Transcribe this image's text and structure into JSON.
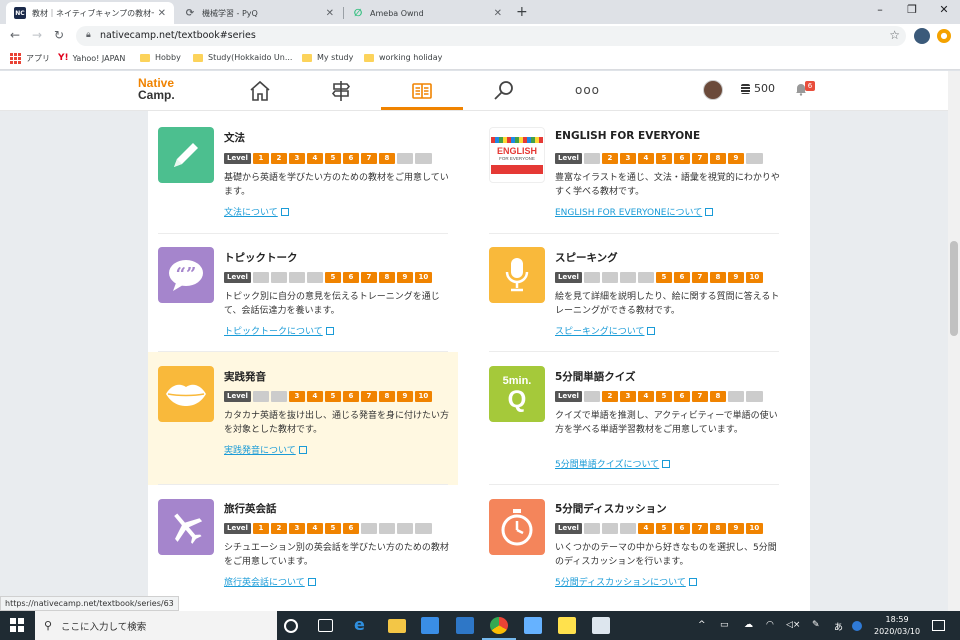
{
  "browser": {
    "tabs": [
      {
        "favicon": "NC",
        "title": "教材｜ネイティブキャンプの教材一覧",
        "active": true
      },
      {
        "favicon": "⟳",
        "title": "機械学習 - PyQ",
        "active": false
      },
      {
        "favicon": "∅",
        "title": "Ameba Ownd",
        "active": false
      }
    ],
    "url": "nativecamp.net/textbook#series",
    "bookmarks": [
      "アプリ",
      "Yahoo! JAPAN",
      "Hobby",
      "Study(Hokkaido Un...",
      "My study",
      "working holiday"
    ]
  },
  "site": {
    "logo_line1": "Native",
    "logo_line2": "Camp.",
    "coins": "500",
    "notification_count": "6",
    "more_dots": "ooo"
  },
  "level_label": "Level",
  "cards": [
    {
      "title": "文法",
      "levels": [
        1,
        1,
        1,
        1,
        1,
        1,
        1,
        1,
        0,
        0
      ],
      "desc": "基礎から英語を学びたい方のための教材をご用意しています。",
      "link": "文法について",
      "icon": "pencil-icon",
      "color": "#4cbf8f"
    },
    {
      "title": "ENGLISH FOR EVERYONE",
      "levels": [
        0,
        1,
        1,
        1,
        1,
        1,
        1,
        1,
        1,
        0
      ],
      "desc": "豊富なイラストを通じ、文法・語彙を視覚的にわかりやすく学べる教材です。",
      "link": "ENGLISH FOR EVERYONEについて",
      "icon": "book-cover-icon",
      "color": "#ffffff"
    },
    {
      "title": "トピックトーク",
      "levels": [
        0,
        0,
        0,
        0,
        1,
        1,
        1,
        1,
        1,
        1
      ],
      "desc": "トピック別に自分の意見を伝えるトレーニングを通じて、会話伝達力を養います。",
      "link": "トピックトークについて",
      "icon": "speech-bubble-icon",
      "color": "#a585cc"
    },
    {
      "title": "スピーキング",
      "levels": [
        0,
        0,
        0,
        0,
        1,
        1,
        1,
        1,
        1,
        1
      ],
      "desc": "絵を見て詳細を説明したり、絵に関する質問に答えるトレーニングができる教材です。",
      "link": "スピーキングについて",
      "icon": "microphone-icon",
      "color": "#f9b93b"
    },
    {
      "title": "実践発音",
      "levels": [
        0,
        0,
        1,
        1,
        1,
        1,
        1,
        1,
        1,
        1
      ],
      "desc": "カタカナ英語を抜け出し、通じる発音を身に付けたい方を対象とした教材です。",
      "link": "実践発音について",
      "icon": "lips-icon",
      "color": "#f9b93b"
    },
    {
      "title": "5分間単語クイズ",
      "levels": [
        0,
        1,
        1,
        1,
        1,
        1,
        1,
        1,
        0,
        0
      ],
      "desc": "クイズで単語を推測し、アクティビティーで単語の使い方を学べる単語学習教材をご用意しています。",
      "link": "5分間単語クイズについて",
      "icon": "quiz-5min-icon",
      "color": "#a5c93a",
      "icon_text_top": "5min.",
      "icon_text_big": "Q"
    },
    {
      "title": "旅行英会話",
      "levels": [
        1,
        1,
        1,
        1,
        1,
        1,
        0,
        0,
        0,
        0
      ],
      "desc": "シチュエーション別の英会話を学びたい方のための教材をご用意しています。",
      "link": "旅行英会話について",
      "icon": "airplane-icon",
      "color": "#a585cc"
    },
    {
      "title": "5分間ディスカッション",
      "levels": [
        0,
        0,
        0,
        1,
        1,
        1,
        1,
        1,
        1,
        1
      ],
      "desc": "いくつかのテーマの中から好きなものを選択し、5分間のディスカッションを行います。",
      "link": "5分間ディスカッションについて",
      "icon": "stopwatch-icon",
      "color": "#f4855b"
    }
  ],
  "status_url": "https://nativecamp.net/textbook/series/63",
  "taskbar": {
    "search_placeholder": "ここに入力して検索",
    "time": "18:59",
    "date": "2020/03/10",
    "ime": "あ"
  }
}
